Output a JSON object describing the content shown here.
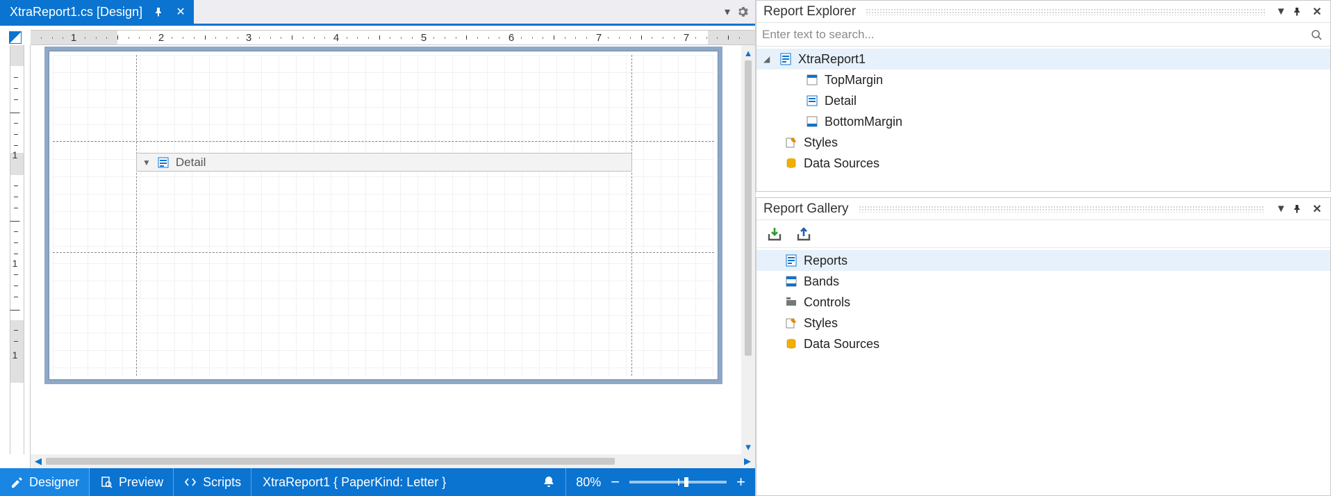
{
  "document": {
    "tab_title": "XtraReport1.cs [Design]"
  },
  "designer": {
    "band_label": "Detail",
    "ruler_inches": [
      1,
      2,
      3,
      4,
      5,
      6,
      7
    ],
    "vruler_marks": [
      "-",
      "-",
      "-",
      "—",
      "-",
      "-",
      "-",
      "1"
    ]
  },
  "status": {
    "tabs": {
      "designer": "Designer",
      "preview": "Preview",
      "scripts": "Scripts"
    },
    "report_info": "XtraReport1 { PaperKind: Letter }",
    "zoom_label": "80%"
  },
  "explorer": {
    "title": "Report Explorer",
    "search_placeholder": "Enter text to search...",
    "tree": {
      "root": "XtraReport1",
      "bands": [
        "TopMargin",
        "Detail",
        "BottomMargin"
      ],
      "styles": "Styles",
      "data_sources": "Data Sources"
    }
  },
  "gallery": {
    "title": "Report Gallery",
    "items": {
      "reports": "Reports",
      "bands": "Bands",
      "controls": "Controls",
      "styles": "Styles",
      "data_sources": "Data Sources"
    }
  }
}
